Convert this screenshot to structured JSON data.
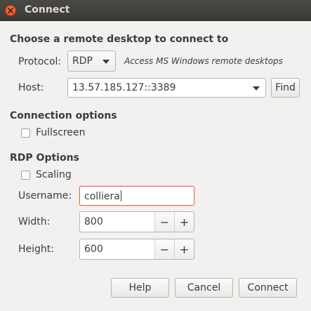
{
  "window": {
    "title": "Connect"
  },
  "remote": {
    "section_title": "Choose a remote desktop to connect to",
    "protocol_label": "Protocol:",
    "protocol_value": "RDP",
    "protocol_hint": "Access MS Windows remote desktops",
    "host_label": "Host:",
    "host_value": "13.57.185.127::3389",
    "find_label": "Find"
  },
  "connection_options": {
    "section_title": "Connection options",
    "fullscreen_label": "Fullscreen",
    "fullscreen_checked": false
  },
  "rdp_options": {
    "section_title": "RDP Options",
    "scaling_label": "Scaling",
    "scaling_checked": false,
    "username_label": "Username:",
    "username_value": "colliera",
    "width_label": "Width:",
    "width_value": "800",
    "height_label": "Height:",
    "height_value": "600",
    "decrement": "−",
    "increment": "+"
  },
  "footer": {
    "help_label": "Help",
    "cancel_label": "Cancel",
    "connect_label": "Connect"
  },
  "icons": {
    "close": "close-icon",
    "dropdown": "chevron-down-icon"
  },
  "colors": {
    "accent": "#e0794e",
    "close": "#df4a16",
    "titlebar": "#3b3a36"
  }
}
